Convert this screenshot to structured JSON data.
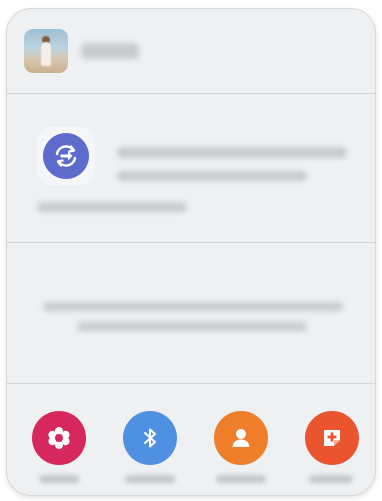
{
  "header": {
    "title": "",
    "thumbnail_icon": "photo-thumbnail"
  },
  "smart_view": {
    "icon": "smart-view-icon",
    "title": "",
    "description": ""
  },
  "message": {
    "text": ""
  },
  "apps": [
    {
      "label": "",
      "icon": "flower-icon",
      "color": "#d7285e"
    },
    {
      "label": "",
      "icon": "bluetooth-icon",
      "color": "#4f90e0"
    },
    {
      "label": "",
      "icon": "contact-icon",
      "color": "#ef7e2b"
    },
    {
      "label": "",
      "icon": "add-note-icon",
      "color": "#ea5530"
    }
  ],
  "colors": {
    "panel": "#eef0f2",
    "divider": "#d3d6d9",
    "smart_view": "#5d6ccc"
  }
}
